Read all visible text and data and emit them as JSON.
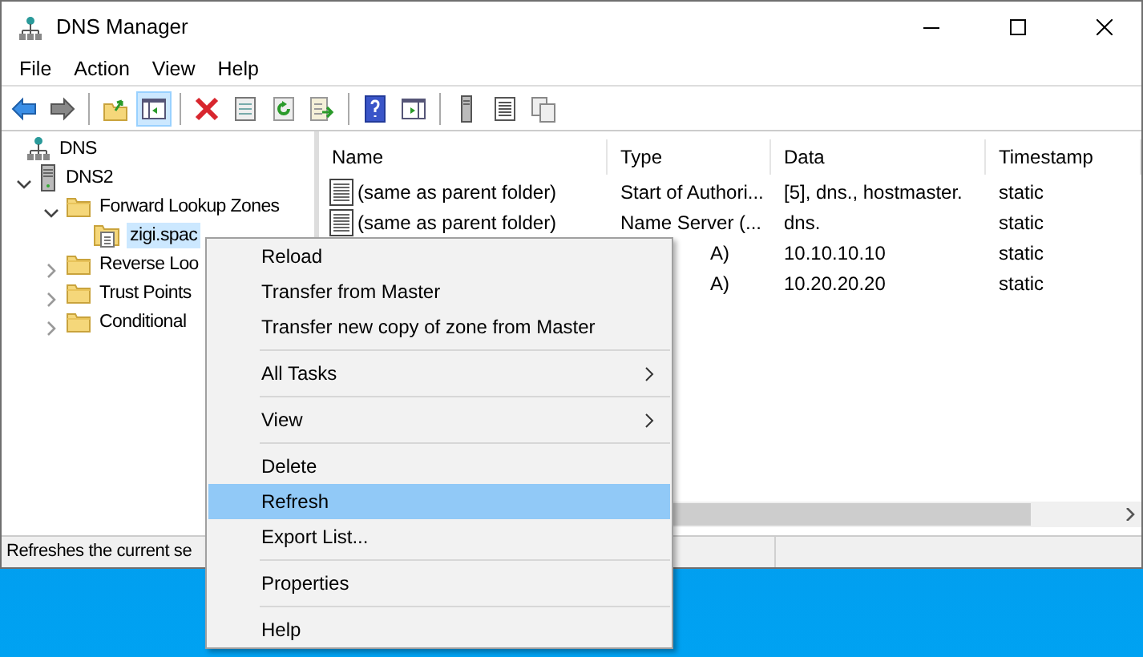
{
  "window": {
    "title": "DNS Manager"
  },
  "menu_bar": [
    "File",
    "Action",
    "View",
    "Help"
  ],
  "toolbar": [
    {
      "kind": "back"
    },
    {
      "kind": "forward"
    },
    {
      "kind": "sep"
    },
    {
      "kind": "up"
    },
    {
      "kind": "pane",
      "selected": true
    },
    {
      "kind": "sep"
    },
    {
      "kind": "delete"
    },
    {
      "kind": "properties"
    },
    {
      "kind": "refresh"
    },
    {
      "kind": "export"
    },
    {
      "kind": "sep"
    },
    {
      "kind": "help"
    },
    {
      "kind": "actionpane"
    },
    {
      "kind": "sep"
    },
    {
      "kind": "server"
    },
    {
      "kind": "list"
    },
    {
      "kind": "copy"
    }
  ],
  "tree": [
    {
      "label": "DNS",
      "kind": "root",
      "children": [
        {
          "label": "DNS2",
          "kind": "server",
          "expanded": true,
          "children": [
            {
              "label": "Forward Lookup Zones",
              "kind": "folder",
              "expanded": true,
              "children": [
                {
                  "label": "zigi.spac",
                  "kind": "zone",
                  "selected": true
                }
              ]
            },
            {
              "label": "Reverse Loo",
              "kind": "folder",
              "expanded": false,
              "selected": false
            },
            {
              "label": "Trust Points",
              "kind": "folder",
              "expanded": false,
              "selected": false
            },
            {
              "label": "Conditional",
              "kind": "folder",
              "expanded": false,
              "selected": false
            }
          ]
        }
      ]
    }
  ],
  "table": {
    "columns": [
      "Name",
      "Type",
      "Data",
      "Timestamp"
    ],
    "rows": [
      {
        "name": "(same as parent folder)",
        "type": "Start of Authori...",
        "data": "[5], dns., hostmaster.",
        "timestamp": "static"
      },
      {
        "name": "(same as parent folder)",
        "type": "Name Server (...",
        "data": "dns.",
        "timestamp": "static"
      },
      {
        "type": "A)",
        "data": "10.10.10.10",
        "timestamp": "static"
      },
      {
        "type": "A)",
        "data": "10.20.20.20",
        "timestamp": "static"
      }
    ]
  },
  "status_bar": "Refreshes the current se",
  "context_menu": [
    {
      "kind": "item",
      "label": "Reload",
      "selected": false
    },
    {
      "kind": "item",
      "label": "Transfer from Master",
      "selected": false
    },
    {
      "kind": "item",
      "label": "Transfer new copy of zone from Master",
      "selected": false
    },
    {
      "kind": "separator"
    },
    {
      "kind": "item",
      "label": "All Tasks",
      "submenu": true,
      "selected": false
    },
    {
      "kind": "separator"
    },
    {
      "kind": "item",
      "label": "View",
      "submenu": true,
      "selected": false
    },
    {
      "kind": "separator"
    },
    {
      "kind": "item",
      "label": "Delete",
      "selected": false
    },
    {
      "kind": "item",
      "label": "Refresh",
      "selected": true
    },
    {
      "kind": "item",
      "label": "Export List...",
      "selected": false
    },
    {
      "kind": "separator"
    },
    {
      "kind": "item",
      "label": "Properties",
      "selected": false
    },
    {
      "kind": "separator"
    },
    {
      "kind": "item",
      "label": "Help",
      "selected": false
    }
  ]
}
